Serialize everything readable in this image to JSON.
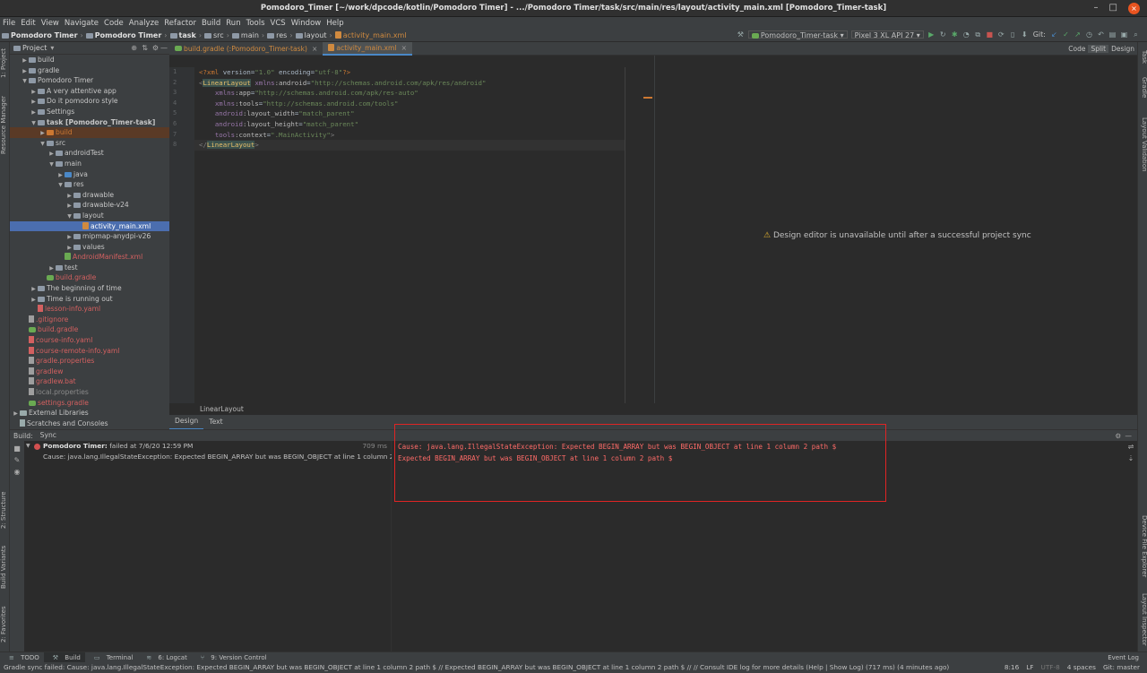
{
  "window": {
    "title": "Pomodoro_Timer [~/work/dpcode/kotlin/Pomodoro Timer] - .../Pomodoro Timer/task/src/main/res/layout/activity_main.xml [Pomodoro_Timer-task]",
    "minimize": "–",
    "maximize": "□",
    "close": "×"
  },
  "menu": [
    "File",
    "Edit",
    "View",
    "Navigate",
    "Code",
    "Analyze",
    "Refactor",
    "Build",
    "Run",
    "Tools",
    "VCS",
    "Window",
    "Help"
  ],
  "navbar": {
    "crumbs": [
      "Pomodoro Timer",
      "Pomodoro Timer",
      "task",
      "src",
      "main",
      "res",
      "layout",
      "activity_main.xml"
    ],
    "run_config": "Pomodoro_Timer-task",
    "device": "Pixel 3 XL API 27",
    "git_label": "Git:"
  },
  "left_stripe": [
    "1: Project",
    "Resource Manager",
    "2: Structure",
    "Build Variants",
    "2: Favorites"
  ],
  "right_stripe": [
    "Task",
    "Gradle",
    "Layout Validation",
    "Device File Explorer",
    "Layout Inspector"
  ],
  "project": {
    "header": "Project",
    "tree": [
      {
        "depth": 0,
        "arrow": "▶",
        "icon": "folder",
        "label": "build",
        "color": "normal"
      },
      {
        "depth": 0,
        "arrow": "▶",
        "icon": "folder",
        "label": "gradle",
        "color": "normal"
      },
      {
        "depth": 0,
        "arrow": "▼",
        "icon": "folder",
        "label": "Pomodoro Timer",
        "color": "normal"
      },
      {
        "depth": 1,
        "arrow": "▶",
        "icon": "folder",
        "label": "A very attentive app",
        "color": "normal"
      },
      {
        "depth": 1,
        "arrow": "▶",
        "icon": "folder",
        "label": "Do it pomodoro style",
        "color": "normal"
      },
      {
        "depth": 1,
        "arrow": "▶",
        "icon": "folder",
        "label": "Settings",
        "color": "normal"
      },
      {
        "depth": 1,
        "arrow": "▼",
        "icon": "folder",
        "label": "task [Pomodoro_Timer-task]",
        "color": "bold"
      },
      {
        "depth": 2,
        "arrow": "▶",
        "icon": "folder-orange",
        "label": "build",
        "color": "orange",
        "highlight": true
      },
      {
        "depth": 2,
        "arrow": "▼",
        "icon": "folder",
        "label": "src",
        "color": "normal"
      },
      {
        "depth": 3,
        "arrow": "▶",
        "icon": "folder",
        "label": "androidTest",
        "color": "normal"
      },
      {
        "depth": 3,
        "arrow": "▼",
        "icon": "folder",
        "label": "main",
        "color": "normal"
      },
      {
        "depth": 4,
        "arrow": "▶",
        "icon": "folder-blue",
        "label": "java",
        "color": "normal"
      },
      {
        "depth": 4,
        "arrow": "▼",
        "icon": "folder",
        "label": "res",
        "color": "normal"
      },
      {
        "depth": 5,
        "arrow": "▶",
        "icon": "folder",
        "label": "drawable",
        "color": "normal"
      },
      {
        "depth": 5,
        "arrow": "▶",
        "icon": "folder",
        "label": "drawable-v24",
        "color": "normal"
      },
      {
        "depth": 5,
        "arrow": "▼",
        "icon": "folder",
        "label": "layout",
        "color": "normal"
      },
      {
        "depth": 6,
        "arrow": "",
        "icon": "xml",
        "label": "activity_main.xml",
        "color": "normal",
        "selected": true
      },
      {
        "depth": 5,
        "arrow": "▶",
        "icon": "folder",
        "label": "mipmap-anydpi-v26",
        "color": "normal"
      },
      {
        "depth": 5,
        "arrow": "▶",
        "icon": "folder",
        "label": "values",
        "color": "normal"
      },
      {
        "depth": 4,
        "arrow": "",
        "icon": "manifest",
        "label": "AndroidManifest.xml",
        "color": "red"
      },
      {
        "depth": 3,
        "arrow": "▶",
        "icon": "folder",
        "label": "test",
        "color": "normal"
      },
      {
        "depth": 2,
        "arrow": "",
        "icon": "gradle",
        "label": "build.gradle",
        "color": "red"
      },
      {
        "depth": 1,
        "arrow": "▶",
        "icon": "folder",
        "label": "The beginning of time",
        "color": "normal"
      },
      {
        "depth": 1,
        "arrow": "▶",
        "icon": "folder",
        "label": "Time is running out",
        "color": "normal"
      },
      {
        "depth": 1,
        "arrow": "",
        "icon": "yaml",
        "label": "lesson-info.yaml",
        "color": "red"
      },
      {
        "depth": 0,
        "arrow": "",
        "icon": "file",
        "label": ".gitignore",
        "color": "red"
      },
      {
        "depth": 0,
        "arrow": "",
        "icon": "gradle",
        "label": "build.gradle",
        "color": "red"
      },
      {
        "depth": 0,
        "arrow": "",
        "icon": "yaml",
        "label": "course-info.yaml",
        "color": "red"
      },
      {
        "depth": 0,
        "arrow": "",
        "icon": "yaml",
        "label": "course-remote-info.yaml",
        "color": "red"
      },
      {
        "depth": 0,
        "arrow": "",
        "icon": "file",
        "label": "gradle.properties",
        "color": "red"
      },
      {
        "depth": 0,
        "arrow": "",
        "icon": "file",
        "label": "gradlew",
        "color": "red"
      },
      {
        "depth": 0,
        "arrow": "",
        "icon": "file",
        "label": "gradlew.bat",
        "color": "red"
      },
      {
        "depth": 0,
        "arrow": "",
        "icon": "file",
        "label": "local.properties",
        "color": "gray"
      },
      {
        "depth": 0,
        "arrow": "",
        "icon": "gradle",
        "label": "settings.gradle",
        "color": "red"
      },
      {
        "depth": -1,
        "arrow": "▶",
        "icon": "lib",
        "label": "External Libraries",
        "color": "normal"
      },
      {
        "depth": -1,
        "arrow": "",
        "icon": "scratch",
        "label": "Scratches and Consoles",
        "color": "normal"
      }
    ]
  },
  "editor_tabs": [
    {
      "label": "build.gradle (:Pomodoro_Timer-task)",
      "active": false
    },
    {
      "label": "activity_main.xml",
      "active": true
    }
  ],
  "view_modes": [
    "Code",
    "Split",
    "Design"
  ],
  "code_lines": [
    "<?xml version=\"1.0\" encoding=\"utf-8\"?>",
    "<LinearLayout xmlns:android=\"http://schemas.android.com/apk/res/android\"",
    "    xmlns:app=\"http://schemas.android.com/apk/res-auto\"",
    "    xmlns:tools=\"http://schemas.android.com/tools\"",
    "    android:layout_width=\"match_parent\"",
    "    android:layout_height=\"match_parent\"",
    "    tools:context=\".MainActivity\">",
    "</LinearLayout>"
  ],
  "line_numbers": [
    "1",
    "2",
    "3",
    "4",
    "5",
    "6",
    "7",
    "8"
  ],
  "design_message": "Design editor is unavailable until after a successful project sync",
  "editor_breadcrumb": "LinearLayout",
  "design_tabs": [
    "Design",
    "Text"
  ],
  "build": {
    "header": "Build:",
    "tab": "Sync",
    "root_name": "Pomodoro Timer:",
    "root_status": "failed at 7/6/20 12:59 PM",
    "root_time": "709 ms",
    "child": "Cause: java.lang.IllegalStateException: Expected BEGIN_ARRAY but was BEGIN_OBJECT at line 1 column 2",
    "output_lines": [
      "Cause: java.lang.IllegalStateException: Expected BEGIN_ARRAY but was BEGIN_OBJECT at line 1 column 2 path $",
      "Expected BEGIN_ARRAY but was BEGIN_OBJECT at line 1 column 2 path $"
    ]
  },
  "bottom_tools": [
    "TODO",
    "Build",
    "Terminal",
    "6: Logcat",
    "9: Version Control"
  ],
  "event_log": "Event Log",
  "status": {
    "message": "Gradle sync failed: Cause: java.lang.IllegalStateException: Expected BEGIN_ARRAY but was BEGIN_OBJECT at line 1 column 2 path $ // Expected BEGIN_ARRAY but was BEGIN_OBJECT at line 1 column 2 path $ // // Consult IDE log for more details (Help | Show Log) (717 ms) (4 minutes ago)",
    "position": "8:16",
    "line_sep": "LF",
    "encoding": "UTF-8",
    "indent": "4 spaces",
    "branch": "Git: master"
  },
  "colors": {
    "accent": "#4a88c7",
    "error": "#ff6b68",
    "selection": "#4b6eaf",
    "warning": "#e0b030"
  }
}
